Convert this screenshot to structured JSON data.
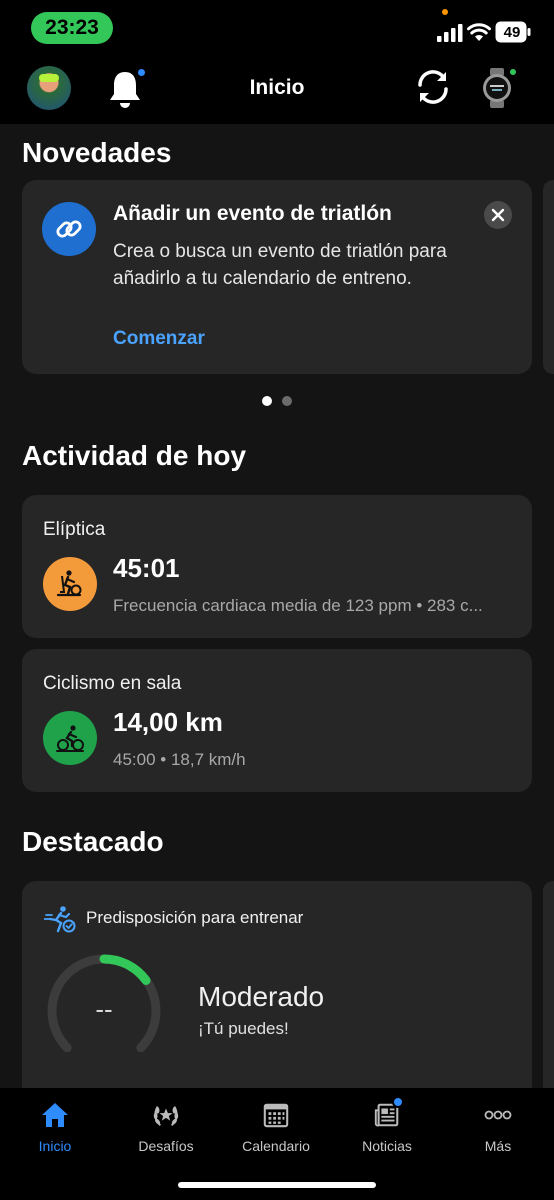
{
  "status_bar": {
    "time": "23:23",
    "battery": "49"
  },
  "header": {
    "title": "Inicio"
  },
  "novedades": {
    "title": "Novedades",
    "card": {
      "title": "Añadir un evento de triatlón",
      "body": "Crea o busca un evento de triatlón para añadirlo a tu calendario de entreno.",
      "link": "Comenzar",
      "icon": "link-icon"
    },
    "pager": {
      "count": 2,
      "active": 1
    }
  },
  "actividad": {
    "title": "Actividad de hoy",
    "items": [
      {
        "label": "Elíptica",
        "value": "45:01",
        "sub": "Frecuencia cardiaca media de 123 ppm • 283 c...",
        "icon": "elliptical-icon",
        "color": "#f39a3a"
      },
      {
        "label": "Ciclismo en sala",
        "value": "14,00 km",
        "sub": "45:00 • 18,7 km/h",
        "icon": "indoor-cycling-icon",
        "color": "#1fa24a"
      }
    ]
  },
  "destacado": {
    "title": "Destacado",
    "card": {
      "label": "Predisposición para entrenar",
      "value": "--",
      "status": "Moderado",
      "sub": "¡Tú puedes!",
      "gauge_fill": 0.2,
      "gauge_color": "#33c759"
    }
  },
  "tab_bar": {
    "tabs": [
      {
        "label": "Inicio",
        "icon": "home-icon",
        "active": true
      },
      {
        "label": "Desafíos",
        "icon": "laurel-icon",
        "active": false
      },
      {
        "label": "Calendario",
        "icon": "calendar-icon",
        "active": false
      },
      {
        "label": "Noticias",
        "icon": "news-icon",
        "active": false
      },
      {
        "label": "Más",
        "icon": "more-icon",
        "active": false
      }
    ]
  }
}
